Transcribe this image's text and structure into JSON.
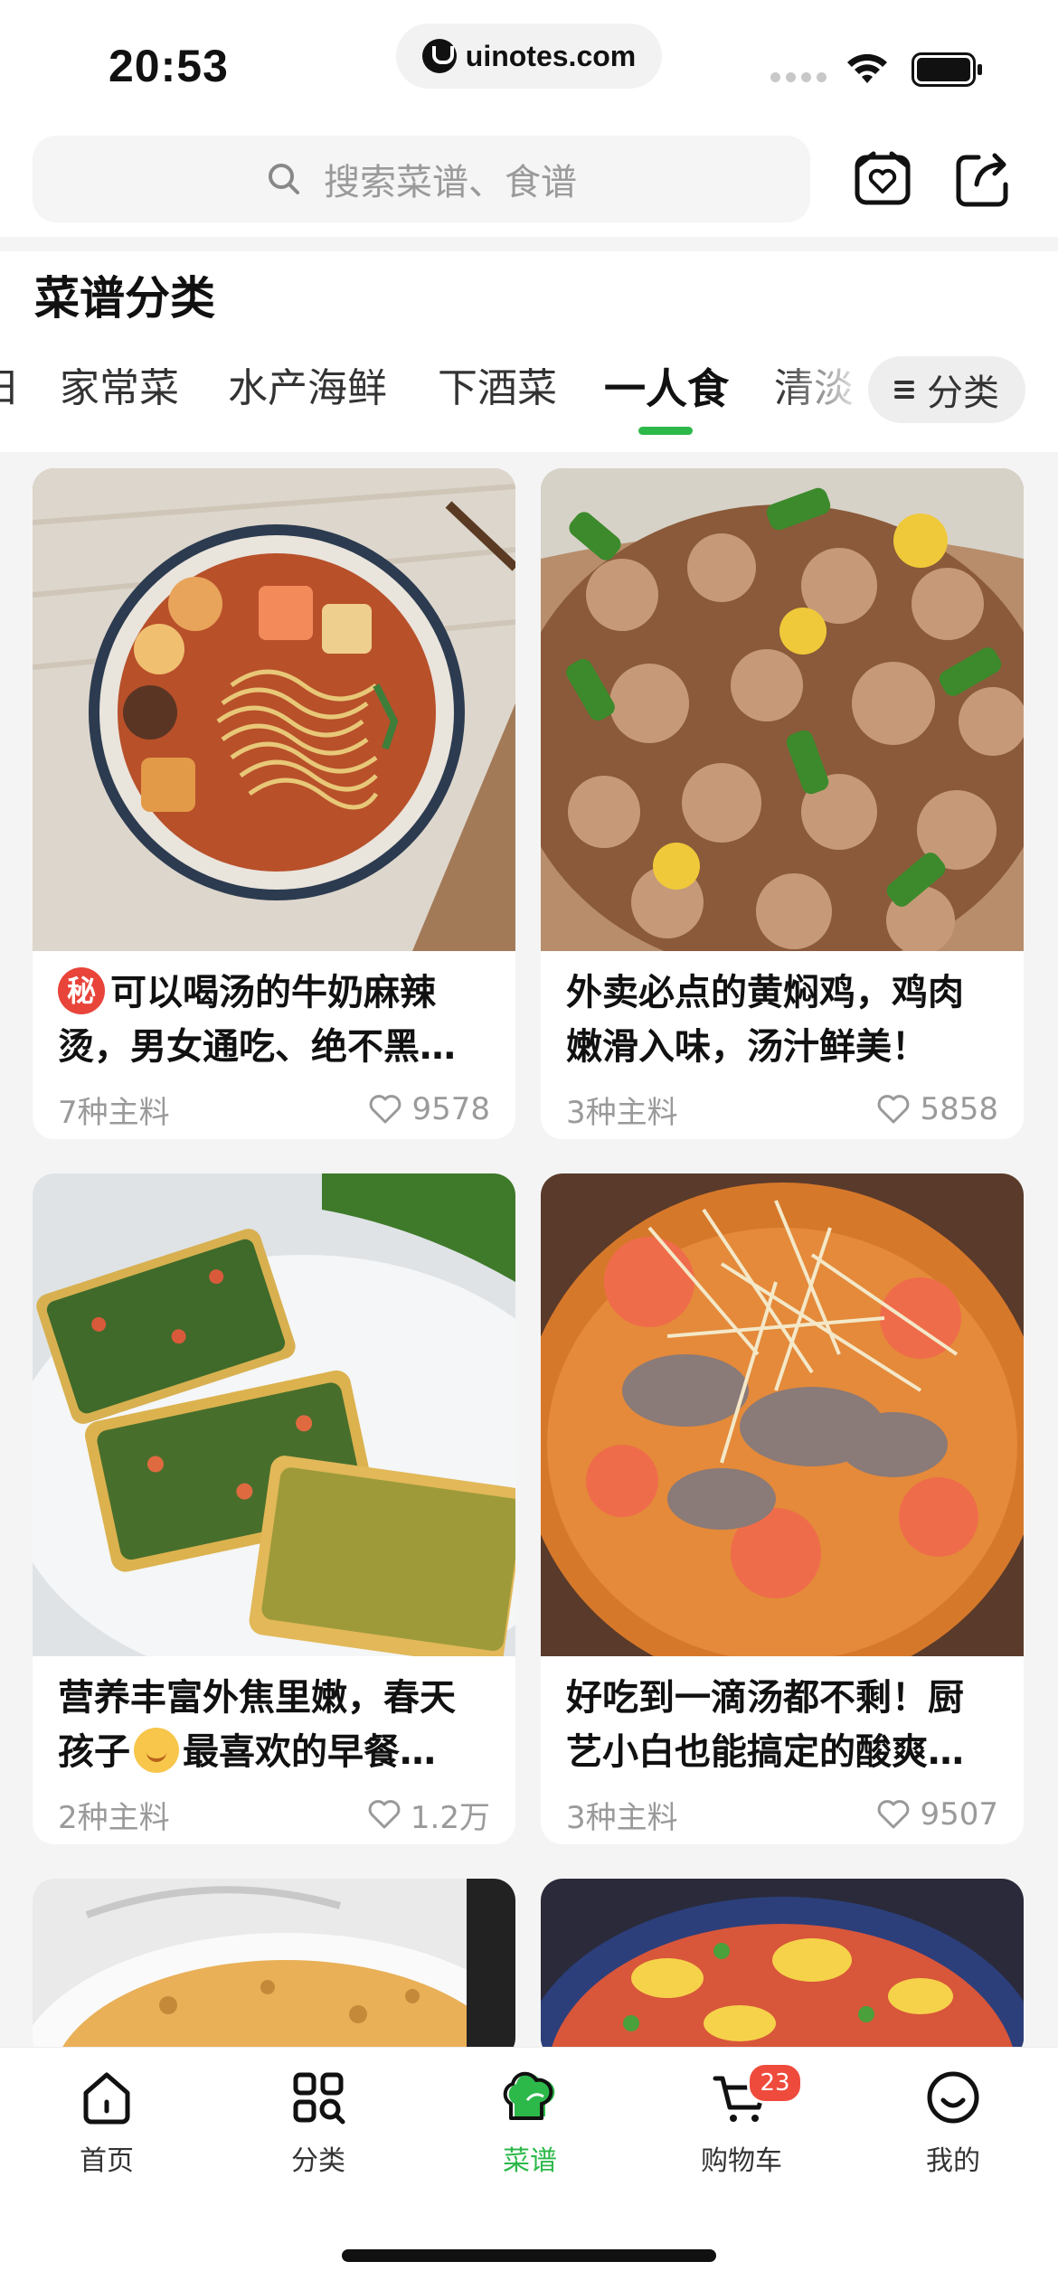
{
  "status_bar": {
    "time": "20:53",
    "url": "uinotes.com"
  },
  "search": {
    "placeholder": "搜索菜谱、食谱"
  },
  "section": {
    "title": "菜谱分类"
  },
  "tabs": [
    {
      "label": "日"
    },
    {
      "label": "家常菜"
    },
    {
      "label": "水产海鲜"
    },
    {
      "label": "下酒菜"
    },
    {
      "label": "一人食",
      "active": true
    },
    {
      "label": "清淡"
    }
  ],
  "category_button": {
    "label": "分类"
  },
  "recipes": [
    {
      "title": "可以喝汤的牛奶麻辣烫，男女通吃、绝不黑…",
      "badge": "秘",
      "ingredients": "7种主料",
      "likes": "9578"
    },
    {
      "title": "外卖必点的黄焖鸡，鸡肉嫩滑入味，汤汁鲜美！",
      "ingredients": "3种主料",
      "likes": "5858"
    },
    {
      "title_part1": "营养丰富外焦里嫩，春天孩子",
      "title_part2": "最喜欢的早餐…",
      "emoji": "baby",
      "ingredients": "2种主料",
      "likes": "1.2万"
    },
    {
      "title": "好吃到一滴汤都不剩！厨艺小白也能搞定的酸爽…",
      "ingredients": "3种主料",
      "likes": "9507"
    }
  ],
  "tabbar": [
    {
      "label": "首页",
      "icon": "home-icon"
    },
    {
      "label": "分类",
      "icon": "grid-search-icon"
    },
    {
      "label": "菜谱",
      "icon": "chef-hat-icon",
      "active": true
    },
    {
      "label": "购物车",
      "icon": "cart-icon",
      "badge": "23"
    },
    {
      "label": "我的",
      "icon": "smiley-icon"
    }
  ],
  "colors": {
    "accent": "#2db84a",
    "badge": "#ef4b3c",
    "muted": "#9a9a9a",
    "background_feed": "#f4f4f4"
  }
}
